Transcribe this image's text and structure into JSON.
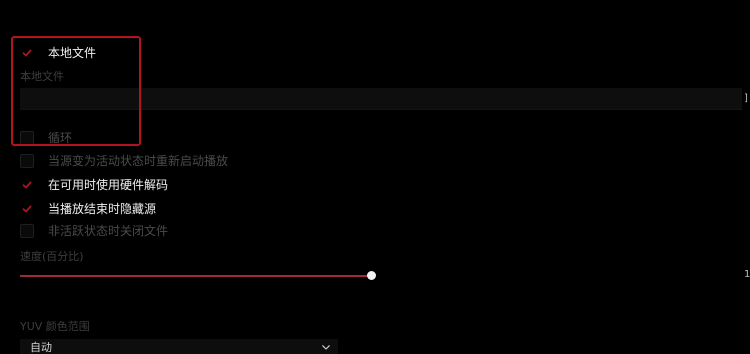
{
  "colors": {
    "accent": "#b3121f",
    "slider_fill": "#a2283a",
    "background": "#000000"
  },
  "local_file": {
    "checkbox_label": "本地文件",
    "checked": true,
    "field_label": "本地文件",
    "value": ""
  },
  "loop": {
    "label": "循环",
    "checked": false
  },
  "restart_on_active": {
    "label": "当源变为活动状态时重新启动播放",
    "checked": false
  },
  "hw_decode": {
    "label": "在可用时使用硬件解码",
    "checked": true
  },
  "hide_on_end": {
    "label": "当播放结束时隐藏源",
    "checked": true
  },
  "close_inactive": {
    "label": "非活跃状态时关闭文件",
    "checked": false
  },
  "speed": {
    "label": "速度(百分比)",
    "value_percent": 100,
    "value_display": "1"
  },
  "yuv": {
    "label": "YUV 颜色范围",
    "selected": "自动",
    "icon": "chevron-down-icon"
  },
  "file_edge_mark": "]"
}
